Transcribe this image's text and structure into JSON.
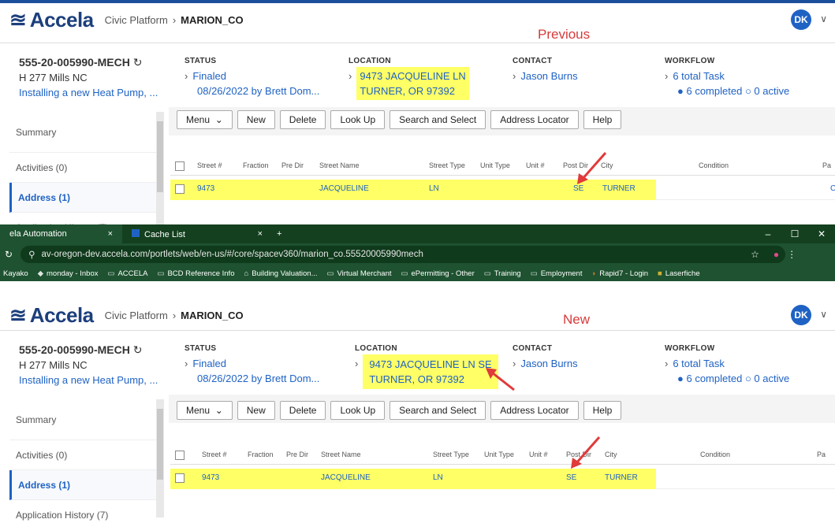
{
  "app": {
    "brand": "Accela",
    "platform": "Civic Platform",
    "agency": "MARION_CO",
    "user_initials": "DK"
  },
  "labels": {
    "previous": "Previous",
    "new": "New"
  },
  "record": {
    "id": "555-20-005990-MECH",
    "address_line": "H 277 Mills NC",
    "description": "Installing a new Heat Pump, ..."
  },
  "status": {
    "heading": "STATUS",
    "value": "Finaled",
    "detail": "08/26/2022 by Brett Dom..."
  },
  "location_prev": {
    "heading": "LOCATION",
    "line1": "9473 JACQUELINE LN",
    "line2": "TURNER, OR 97392"
  },
  "location_new": {
    "heading": "LOCATION",
    "line1": "9473 JACQUELINE LN SE",
    "line2": "TURNER, OR 97392"
  },
  "contact": {
    "heading": "CONTACT",
    "value": "Jason Burns"
  },
  "workflow": {
    "heading": "WORKFLOW",
    "value": "6 total Task",
    "completed": "6 completed",
    "active": "0 active"
  },
  "sidebar": [
    "Summary",
    "Activities (0)",
    "Address (1)",
    "Application History (7)"
  ],
  "toolbar": [
    "Menu",
    "New",
    "Delete",
    "Look Up",
    "Search and Select",
    "Address Locator",
    "Help"
  ],
  "grid": {
    "headers": [
      "Street #",
      "Fraction",
      "Pre Dir",
      "Street Name",
      "Street Type",
      "Unit Type",
      "Unit #",
      "Post Dir",
      "City",
      "Condition",
      "Pa"
    ],
    "row": {
      "street_no": "9473",
      "street_name": "JACQUELINE",
      "street_type": "LN",
      "post_dir": "SE",
      "city": "TURNER",
      "trail": "C"
    }
  },
  "browser": {
    "tabs": [
      "ela Automation",
      "Cache List"
    ],
    "url": "av-oregon-dev.accela.com/portlets/web/en-us/#/core/spacev360/marion_co.55520005990mech",
    "bookmarks": [
      "Kayako",
      "monday - Inbox",
      "ACCELA",
      "BCD Reference Info",
      "Building Valuation...",
      "Virtual Merchant",
      "ePermitting - Other",
      "Training",
      "Employment",
      "Rapid7 - Login",
      "Laserfiche"
    ]
  },
  "colors": {
    "accent": "#1f62c4",
    "highlight": "#ffff66",
    "annotation": "#d63b3b",
    "chrome": "#1e5230"
  }
}
